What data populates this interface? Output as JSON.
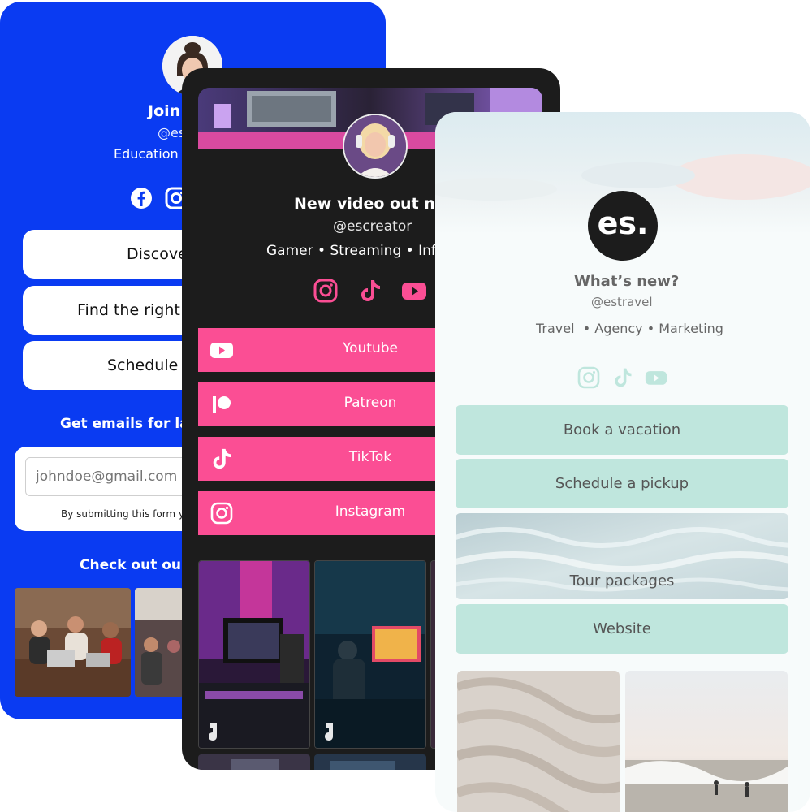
{
  "blue_card": {
    "title": "Join",
    "handle": "@es",
    "tagline": "Education •",
    "buttons": [
      "Discove",
      "Find the right i",
      "Schedule"
    ],
    "emails_heading": "Get emails for la",
    "email_placeholder": "johndoe@gmail.com",
    "form_note": "By submitting this form yo",
    "check_heading": "Check out ou",
    "social_icons": [
      "facebook-icon",
      "instagram-icon"
    ]
  },
  "dark_card": {
    "title": "New video out now",
    "handle": "@escreator",
    "tagline": "Gamer • Streaming • Influ",
    "social_icons": [
      "instagram-icon",
      "tiktok-icon",
      "youtube-icon"
    ],
    "links": [
      {
        "label": "Youtube",
        "icon": "youtube-icon"
      },
      {
        "label": "Patreon",
        "icon": "patreon-icon"
      },
      {
        "label": "TikTok",
        "icon": "tiktok-icon"
      },
      {
        "label": "Instagram",
        "icon": "instagram-icon"
      }
    ],
    "accent": "#fb4e94"
  },
  "light_card": {
    "logo_text": "es.",
    "title": "What’s new?",
    "handle": "@estravel",
    "tagline": "Travel  • Agency • Marketing",
    "social_icons": [
      "instagram-icon",
      "tiktok-icon",
      "youtube-icon"
    ],
    "buttons": [
      "Book a vacation",
      "Schedule a pickup",
      "Tour packages",
      "Website"
    ],
    "accent": "#bfe6dd"
  }
}
